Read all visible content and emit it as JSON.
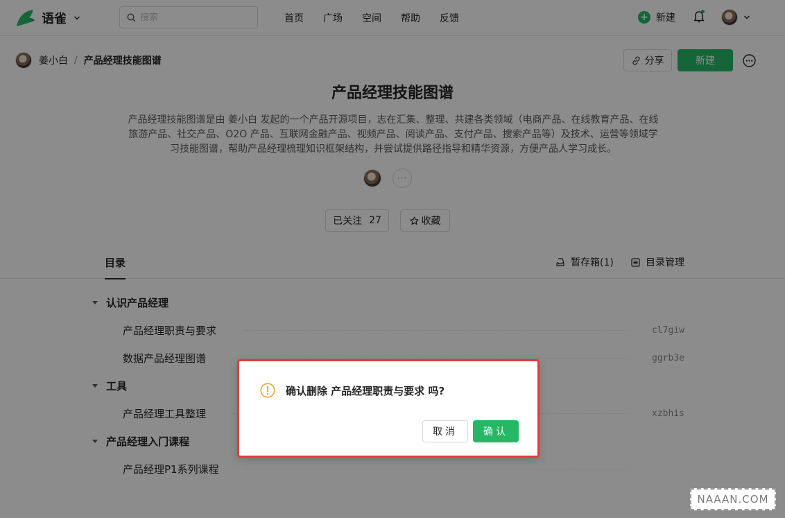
{
  "app": {
    "name": "语雀"
  },
  "header": {
    "search_placeholder": "搜索",
    "nav": [
      "首页",
      "广场",
      "空间",
      "帮助",
      "反馈"
    ],
    "new_label": "新建"
  },
  "breadcrumb": {
    "user": "姜小白",
    "separator": "/",
    "book": "产品经理技能图谱"
  },
  "actions": {
    "share_label": "分享",
    "new_label": "新建"
  },
  "book": {
    "title": "产品经理技能图谱",
    "description": "产品经理技能图谱是由 姜小白 发起的一个产品开源项目，志在汇集、整理、共建各类领域（电商产品、在线教育产品、在线旅游产品、社交产品、O2O 产品、互联网金融产品、视频产品、阅读产品、支付产品、搜索产品等）及技术、运营等领域学习技能图谱，帮助产品经理梳理知识框架结构，并尝试提供路径指导和精华资源，方便产品人学习成长。",
    "more_members": "···",
    "follow_label": "已关注",
    "follow_count": "27",
    "collect_label": "收藏"
  },
  "toc": {
    "tab_label": "目录",
    "draft_label": "暂存箱(1)",
    "manage_label": "目录管理",
    "groups": [
      {
        "title": "认识产品经理"
      },
      {
        "title": "工具"
      },
      {
        "title": "产品经理入门课程"
      }
    ],
    "items": [
      {
        "title": "产品经理职责与要求",
        "slug": "cl7giw"
      },
      {
        "title": "数据产品经理图谱",
        "slug": "ggrb3e"
      },
      {
        "title": "产品经理工具整理",
        "slug": "xzbhis"
      },
      {
        "title": "产品经理P1系列课程",
        "slug": ""
      }
    ]
  },
  "dialog": {
    "message": "确认删除 产品经理职责与要求 吗?",
    "cancel_label": "取消",
    "confirm_label": "确认"
  },
  "watermark": "NAAAN.COM",
  "colors": {
    "brand_green": "#25b864",
    "highlight_red": "#e6393c",
    "warning_orange": "#f0a030"
  }
}
